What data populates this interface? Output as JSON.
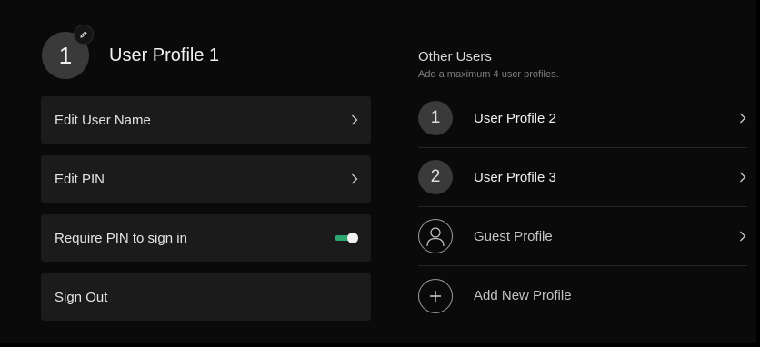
{
  "profile": {
    "initial": "1",
    "name": "User Profile 1"
  },
  "menu": {
    "edit_name": "Edit User Name",
    "edit_pin": "Edit PIN",
    "require_pin": "Require PIN to sign in",
    "require_pin_enabled": true,
    "sign_out": "Sign Out"
  },
  "other_users": {
    "title": "Other Users",
    "subtitle": "Add a maximum 4 user profiles.",
    "users": [
      {
        "initial": "1",
        "name": "User Profile 2"
      },
      {
        "initial": "2",
        "name": "User Profile 3"
      }
    ],
    "guest": {
      "name": "Guest Profile"
    },
    "add": {
      "label": "Add New Profile"
    }
  },
  "colors": {
    "background": "#0a0a0a",
    "row_background": "#1b1b1b",
    "toggle_on": "#2fa66f",
    "avatar": "#3a3a3a"
  },
  "icons": [
    "pencil-icon",
    "chevron-right-icon",
    "person-icon",
    "plus-icon",
    "toggle-switch"
  ]
}
